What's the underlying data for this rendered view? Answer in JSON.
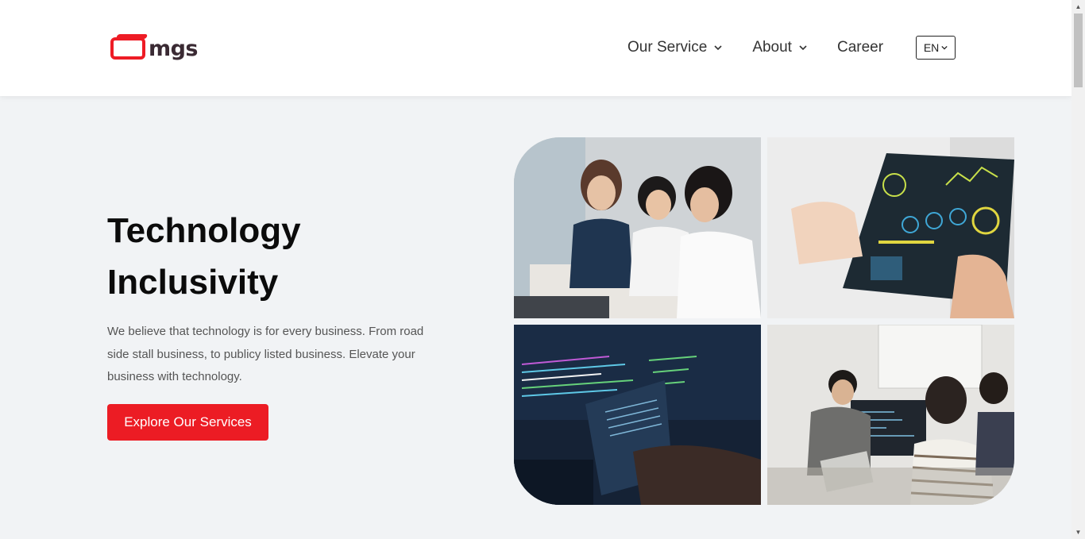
{
  "header": {
    "logo_text": "mgs",
    "nav": [
      {
        "label": "Our Service",
        "has_dropdown": true
      },
      {
        "label": "About",
        "has_dropdown": true
      },
      {
        "label": "Career",
        "has_dropdown": false
      }
    ],
    "language": "EN"
  },
  "hero": {
    "title_line1": "Technology",
    "title_line2": "Inclusivity",
    "description": "We believe that technology is for every business. From road side stall business, to publicy listed business. Elevate your business with technology.",
    "cta_label": "Explore Our Services"
  },
  "images": [
    {
      "icon": "team-meeting-photo"
    },
    {
      "icon": "tablet-dashboard-photo"
    },
    {
      "icon": "code-screen-photo"
    },
    {
      "icon": "developers-office-photo"
    }
  ],
  "colors": {
    "brand_red": "#ec1c24",
    "background": "#f1f3f5",
    "header_bg": "#ffffff",
    "text_dark": "#0b0b0b",
    "text_muted": "#555555"
  }
}
